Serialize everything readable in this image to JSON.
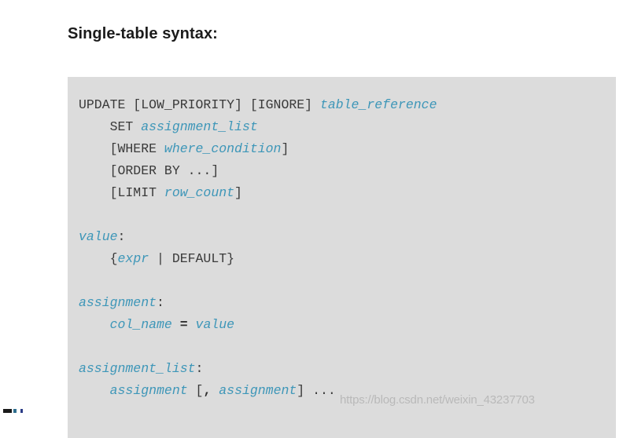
{
  "page": {
    "background_color": "#ffffff",
    "title": "Single-table syntax:"
  },
  "code_block": {
    "background_color": "#dcdcdc",
    "keyword_color": "#3a3a3a",
    "placeholder_color": "#3d96b8",
    "language": "sql",
    "plain_text": "UPDATE [LOW_PRIORITY] [IGNORE] table_reference\n    SET assignment_list\n    [WHERE where_condition]\n    [ORDER BY ...]\n    [LIMIT row_count]\n\nvalue:\n    {expr | DEFAULT}\n\nassignment:\n    col_name = value\n\nassignment_list:\n    assignment [, assignment] ...",
    "lines": [
      {
        "id": "line-update",
        "tokens": [
          {
            "type": "kw",
            "text": "UPDATE [LOW_PRIORITY] [IGNORE] "
          },
          {
            "type": "var",
            "text": "table_reference"
          }
        ]
      },
      {
        "id": "line-set",
        "tokens": [
          {
            "type": "kw",
            "text": "    SET "
          },
          {
            "type": "var",
            "text": "assignment_list"
          }
        ]
      },
      {
        "id": "line-where",
        "tokens": [
          {
            "type": "kw",
            "text": "    [WHERE "
          },
          {
            "type": "var",
            "text": "where_condition"
          },
          {
            "type": "kw",
            "text": "]"
          }
        ]
      },
      {
        "id": "line-order-by",
        "tokens": [
          {
            "type": "kw",
            "text": "    [ORDER BY ...]"
          }
        ]
      },
      {
        "id": "line-limit",
        "tokens": [
          {
            "type": "kw",
            "text": "    [LIMIT "
          },
          {
            "type": "var",
            "text": "row_count"
          },
          {
            "type": "kw",
            "text": "]"
          }
        ]
      },
      {
        "id": "line-blank-1",
        "tokens": []
      },
      {
        "id": "line-value-label",
        "tokens": [
          {
            "type": "var",
            "text": "value"
          },
          {
            "type": "kw",
            "text": ":"
          }
        ]
      },
      {
        "id": "line-value-body",
        "tokens": [
          {
            "type": "kw",
            "text": "    {"
          },
          {
            "type": "var",
            "text": "expr"
          },
          {
            "type": "kw",
            "text": " | DEFAULT}"
          }
        ]
      },
      {
        "id": "line-blank-2",
        "tokens": []
      },
      {
        "id": "line-assignment-label",
        "tokens": [
          {
            "type": "var",
            "text": "assignment"
          },
          {
            "type": "kw",
            "text": ":"
          }
        ]
      },
      {
        "id": "line-assignment-body",
        "tokens": [
          {
            "type": "kw",
            "text": "    "
          },
          {
            "type": "var",
            "text": "col_name"
          },
          {
            "type": "kw",
            "text": " "
          },
          {
            "type": "op",
            "text": "="
          },
          {
            "type": "kw",
            "text": " "
          },
          {
            "type": "var",
            "text": "value"
          }
        ]
      },
      {
        "id": "line-blank-3",
        "tokens": []
      },
      {
        "id": "line-assignment-list-label",
        "tokens": [
          {
            "type": "var",
            "text": "assignment_list"
          },
          {
            "type": "kw",
            "text": ":"
          }
        ]
      },
      {
        "id": "line-assignment-list-body",
        "tokens": [
          {
            "type": "kw",
            "text": "    "
          },
          {
            "type": "var",
            "text": "assignment"
          },
          {
            "type": "kw",
            "text": " ["
          },
          {
            "type": "op",
            "text": ","
          },
          {
            "type": "kw",
            "text": " "
          },
          {
            "type": "var",
            "text": "assignment"
          },
          {
            "type": "kw",
            "text": "] ..."
          }
        ]
      }
    ]
  },
  "watermark": {
    "text": "https://blog.csdn.net/weixin_43237703",
    "color": "#b9b9b9"
  }
}
